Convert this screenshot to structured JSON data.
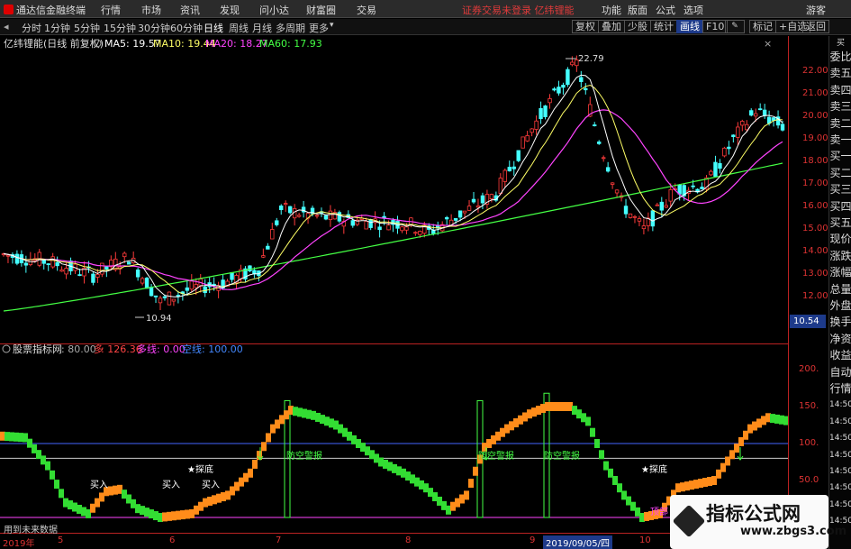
{
  "titlebar": {
    "app_name": "通达信金融终端",
    "menus": [
      "行情",
      "市场",
      "资讯",
      "发现",
      "问小达",
      "财富圈",
      "交易"
    ],
    "warning": "证券交易未登录  亿纬锂能",
    "right_menus": [
      "功能",
      "版面",
      "公式",
      "选项"
    ],
    "guest": "游客"
  },
  "toolbar": {
    "periods": [
      "分时",
      "1分钟",
      "5分钟",
      "15分钟",
      "30分钟",
      "60分钟",
      "日线",
      "周线",
      "月线",
      "多周期",
      "更多"
    ],
    "active_period": "日线",
    "right_buttons": [
      "复权",
      "叠加",
      "少股",
      "统计",
      "画线",
      "F10",
      "标记",
      "+自选",
      "返回"
    ]
  },
  "main_chart": {
    "header_name": "亿纬锂能(日线 前复权)",
    "ma5": "MA5: 19.57",
    "ma10": "MA10: 19.44",
    "ma20": "MA20: 18.27",
    "ma60": "MA60: 17.93",
    "high_label": "22.79",
    "low_label": "10.94",
    "colors": {
      "ma5": "#ffffff",
      "ma10": "#ffff66",
      "ma20": "#ff44ff",
      "ma60": "#44ff44",
      "up": "#ff3b3b",
      "down": "#44ffff"
    }
  },
  "indicator": {
    "name": "股票指标网",
    "v1": ": 80.00",
    "v2_label": "多",
    "v2": ": 126.36",
    "v3_label": "多线",
    "v3": ": 0.00",
    "v4_label": "空线",
    "v4": ": 100.00",
    "labels": [
      "买入",
      "买入",
      "买入",
      "★探底",
      "★探底",
      "防空警报",
      "防空警报",
      "防空警报",
      "顶部"
    ],
    "note": "用到未来数据"
  },
  "right_axis": {
    "price_ticks": [
      "22.00",
      "21.00",
      "20.00",
      "19.00",
      "18.00",
      "17.00",
      "16.00",
      "15.00",
      "14.00",
      "13.00",
      "12.00"
    ],
    "current_price": "10.54",
    "indicator_ticks": [
      "200.",
      "150.",
      "100.",
      "50.0"
    ]
  },
  "sidebar": {
    "top": "买",
    "items": [
      "委比",
      "卖五",
      "卖四",
      "卖三",
      "卖二",
      "卖一",
      "买一",
      "买二",
      "买三",
      "买四",
      "买五",
      "现价",
      "涨跌",
      "涨幅",
      "总量",
      "外盘",
      "换手",
      "净资",
      "收益",
      "自动",
      "行情",
      "14:50",
      "14:50",
      "14:50",
      "14:50",
      "14:50",
      "14:50",
      "14:50",
      "14:50"
    ]
  },
  "bottom_axis": {
    "ticks": [
      "2019年",
      "5",
      "6",
      "7",
      "8",
      "9",
      "2019/09/05/四",
      "10"
    ]
  },
  "watermark": {
    "title": "指标公式网",
    "url": "www.zbgs3.com"
  }
}
